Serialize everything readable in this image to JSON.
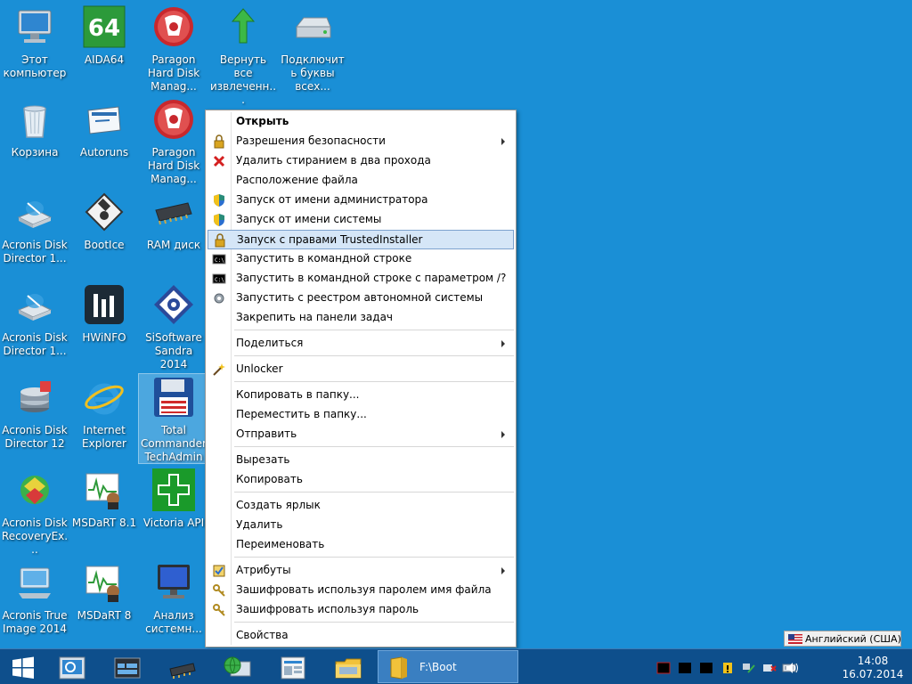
{
  "desktop": {
    "icons": [
      {
        "label": "Этот компьютер",
        "icon": "computer-icon"
      },
      {
        "label": "AIDA64",
        "icon": "aida64-icon"
      },
      {
        "label": "Paragon Hard Disk Manag...",
        "icon": "paragon-icon"
      },
      {
        "label": "Вернуть все извлеченн...",
        "icon": "green-arrow-icon"
      },
      {
        "label": "Подключить буквы всех...",
        "icon": "drive-icon"
      },
      {
        "label": "Корзина",
        "icon": "recycle-bin-icon"
      },
      {
        "label": "Autoruns",
        "icon": "autoruns-icon"
      },
      {
        "label": "Paragon Hard Disk Manag...",
        "icon": "paragon-icon"
      },
      {
        "label": "Acronis Disk Director 1...",
        "icon": "acronis-disk-icon"
      },
      {
        "label": "BootIce",
        "icon": "floppy-icon"
      },
      {
        "label": "RAM диск",
        "icon": "ram-chip-icon"
      },
      {
        "label": "Acronis Disk Director 1...",
        "icon": "acronis-disk-icon"
      },
      {
        "label": "HWiNFO",
        "icon": "hwinfo-icon"
      },
      {
        "label": "SiSoftware Sandra 2014",
        "icon": "sandra-icon"
      },
      {
        "label": "Acronis Disk Director 12",
        "icon": "acronis-stack-icon"
      },
      {
        "label": "Internet Explorer",
        "icon": "internet-explorer-icon"
      },
      {
        "label": "Total Commander TechAdmin",
        "icon": "total-commander-icon"
      },
      {
        "label": "Acronis Disk RecoveryEx...",
        "icon": "acronis-recovery-icon"
      },
      {
        "label": "MSDaRT 8.1",
        "icon": "msdart-icon"
      },
      {
        "label": "Victoria API",
        "icon": "victoria-cross-icon"
      },
      {
        "label": "Acronis True Image 2014",
        "icon": "acronis-true-image-icon"
      },
      {
        "label": "MSDaRT 8",
        "icon": "msdart-icon"
      },
      {
        "label": "Анализ системн...",
        "icon": "monitor-icon"
      }
    ]
  },
  "context_menu": {
    "items": [
      {
        "label": "Открыть",
        "icon": "",
        "bold": true
      },
      {
        "label": "Разрешения безопасности",
        "icon": "lock-icon",
        "submenu": true
      },
      {
        "label": "Удалить стиранием в два прохода",
        "icon": "red-x-icon"
      },
      {
        "label": "Расположение файла",
        "icon": ""
      },
      {
        "label": "Запуск от имени администратора",
        "icon": "uac-shield-icon"
      },
      {
        "label": "Запуск от имени системы",
        "icon": "uac-shield-icon"
      },
      {
        "label": "Запуск с правами TrustedInstaller",
        "icon": "lock-icon",
        "highlighted": true
      },
      {
        "label": "Запустить в командной строке",
        "icon": "cmd-icon"
      },
      {
        "label": "Запустить в командной строке с параметром /?",
        "icon": "cmd-icon"
      },
      {
        "label": "Запустить с реестром автономной системы",
        "icon": "registry-gear-icon"
      },
      {
        "label": "Закрепить на панели задач",
        "icon": ""
      },
      {
        "label": "Поделиться",
        "icon": "",
        "submenu": true
      },
      {
        "label": "Unlocker",
        "icon": "magic-wand-icon"
      },
      {
        "label": "Копировать в папку...",
        "icon": ""
      },
      {
        "label": "Переместить в папку...",
        "icon": ""
      },
      {
        "label": "Отправить",
        "icon": "",
        "submenu": true
      },
      {
        "label": "Вырезать",
        "icon": ""
      },
      {
        "label": "Копировать",
        "icon": ""
      },
      {
        "label": "Создать ярлык",
        "icon": ""
      },
      {
        "label": "Удалить",
        "icon": ""
      },
      {
        "label": "Переименовать",
        "icon": ""
      },
      {
        "label": "Атрибуты",
        "icon": "attributes-icon",
        "submenu": true
      },
      {
        "label": "Зашифровать используя паролем имя файла",
        "icon": "keys-icon"
      },
      {
        "label": "Зашифровать используя пароль",
        "icon": "keys-icon"
      },
      {
        "label": "Свойства",
        "icon": ""
      }
    ],
    "highlight_color": "#d5e6f7"
  },
  "language_indicator": {
    "label": "Английский (США)",
    "icon": "us-flag-icon"
  },
  "taskbar": {
    "start_icon": "windows-logo-icon",
    "pinned": [
      "magnifier-icon",
      "task-manager-icon",
      "chip-icon",
      "network-globe-icon",
      "control-panel-icon",
      "file-explorer-icon"
    ],
    "active_window": {
      "label": "F:\\Boot",
      "icon": "folder-icon"
    },
    "tray": [
      "black-square-icon",
      "black-square-icon",
      "black-square-icon",
      "action-center-icon",
      "network-icon",
      "safely-remove-icon",
      "keyboard-icon",
      "volume-icon"
    ],
    "clock": {
      "time": "14:08",
      "date": "16.07.2014"
    }
  },
  "colors": {
    "desktop_bg": "#1a8fd6",
    "taskbar_bg": "#0e4f8c"
  }
}
